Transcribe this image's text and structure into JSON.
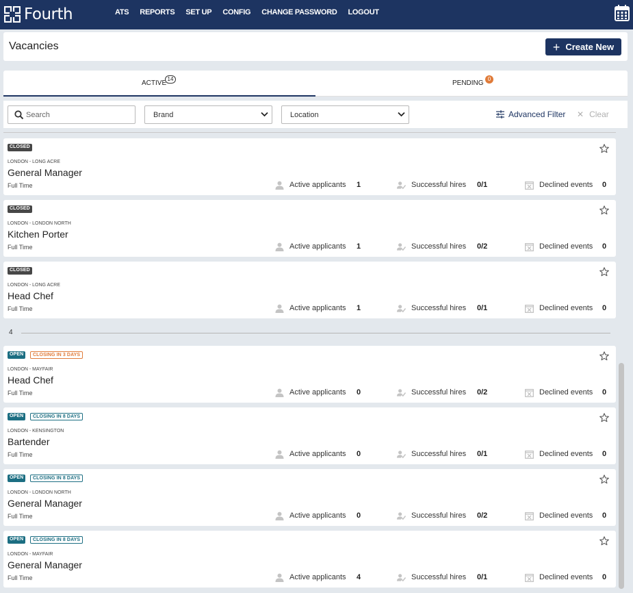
{
  "topnav": {
    "logo_text": "Fourth",
    "links": [
      "ATS",
      "REPORTS",
      "SET UP",
      "CONFIG",
      "CHANGE PASSWORD",
      "LOGOUT"
    ],
    "right_icon": "calendar-icon"
  },
  "header": {
    "title": "Vacancies",
    "create_button": "Create New"
  },
  "tabs": {
    "active": {
      "label": "ACTIVE",
      "count": "14"
    },
    "pending": {
      "label": "PENDING",
      "count": "0"
    }
  },
  "filters": {
    "search_placeholder": "Search",
    "brand": "Brand",
    "location": "Location",
    "advanced": "Advanced Filter",
    "clear": "Clear"
  },
  "stat_labels": {
    "active": "Active applicants",
    "successful": "Successful hires",
    "declined": "Declined events"
  },
  "colors": {
    "navy": "#1d3461",
    "closed_badge": "#474747",
    "open_badge": "#1c6e82",
    "closing_orange": "#e07b39",
    "closing_teal": "#1c6e82"
  },
  "group_label": "4",
  "vacancies": [
    {
      "status": "CLOSED",
      "closing": "",
      "location": "LONDON - LONG ACRE",
      "title": "General Manager",
      "type": "Full Time",
      "active": "1",
      "successful": "0/1",
      "declined": "0"
    },
    {
      "status": "CLOSED",
      "closing": "",
      "location": "LONDON - LONDON NORTH",
      "title": "Kitchen Porter",
      "type": "Full Time",
      "active": "1",
      "successful": "0/2",
      "declined": "0"
    },
    {
      "status": "CLOSED",
      "closing": "",
      "location": "LONDON - LONG ACRE",
      "title": "Head Chef",
      "type": "Full Time",
      "active": "1",
      "successful": "0/1",
      "declined": "0"
    },
    {
      "status": "OPEN",
      "closing": "CLOSING IN 3 DAYS",
      "location": "LONDON - MAYFAIR",
      "title": "Head Chef",
      "type": "Full Time",
      "active": "0",
      "successful": "0/2",
      "declined": "0"
    },
    {
      "status": "OPEN",
      "closing": "CLOSING IN 8 DAYS",
      "location": "LONDON - KENSINGTON",
      "title": "Bartender",
      "type": "Full Time",
      "active": "0",
      "successful": "0/1",
      "declined": "0"
    },
    {
      "status": "OPEN",
      "closing": "CLOSING IN 8 DAYS",
      "location": "LONDON - LONDON NORTH",
      "title": "General Manager",
      "type": "Full Time",
      "active": "0",
      "successful": "0/2",
      "declined": "0"
    },
    {
      "status": "OPEN",
      "closing": "CLOSING IN 8 DAYS",
      "location": "LONDON - MAYFAIR",
      "title": "General Manager",
      "type": "Full Time",
      "active": "4",
      "successful": "0/1",
      "declined": "0"
    }
  ]
}
